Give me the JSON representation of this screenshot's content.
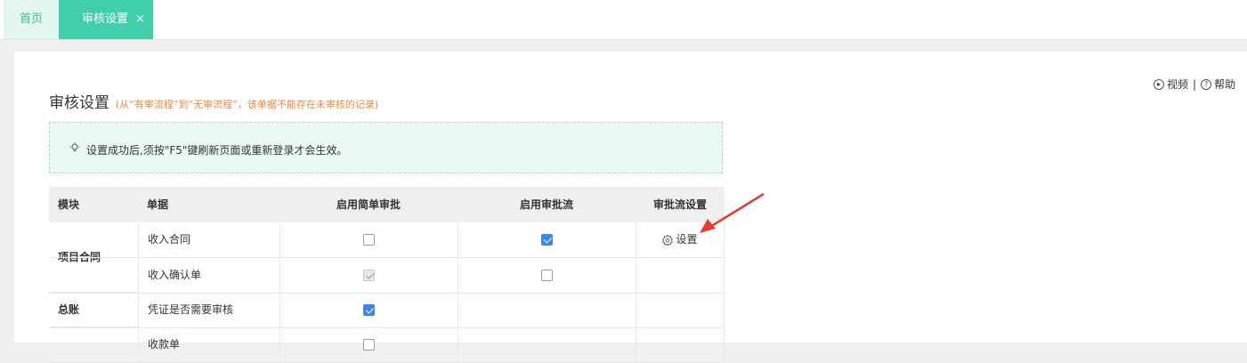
{
  "tabs": [
    {
      "label": "首页",
      "active": false
    },
    {
      "label": "审核设置",
      "active": true,
      "close": "×"
    }
  ],
  "help": {
    "video": "视频",
    "separator": "|",
    "help": "帮助"
  },
  "page": {
    "title": "审核设置",
    "note": "(从“有审流程”到“无审流程”，该单据不能存在未审核的记录)"
  },
  "notice": {
    "text": "设置成功后,须按\"F5\"键刷新页面或重新登录才会生效。"
  },
  "table": {
    "headers": [
      "模块",
      "单据",
      "启用简单审批",
      "启用审批流",
      "审批流设置"
    ],
    "modules": [
      "项目合同",
      "总账"
    ],
    "rows": [
      {
        "doc": "收入合同",
        "simple": "unchecked",
        "flow": "checked",
        "setting": "设置"
      },
      {
        "doc": "收入确认单",
        "simple": "checked-disabled",
        "flow": "unchecked",
        "setting": ""
      },
      {
        "doc": "凭证是否需要审核",
        "simple": "checked",
        "flow": "",
        "setting": ""
      },
      {
        "doc": "收款单",
        "simple": "unchecked",
        "flow": "",
        "setting": ""
      }
    ]
  },
  "colors": {
    "tab_active": "#3fcfa9",
    "tab_home_text": "#41bf9a",
    "note": "#f08a3c",
    "checkbox": "#3c86f1",
    "arrow": "#e83b30"
  }
}
